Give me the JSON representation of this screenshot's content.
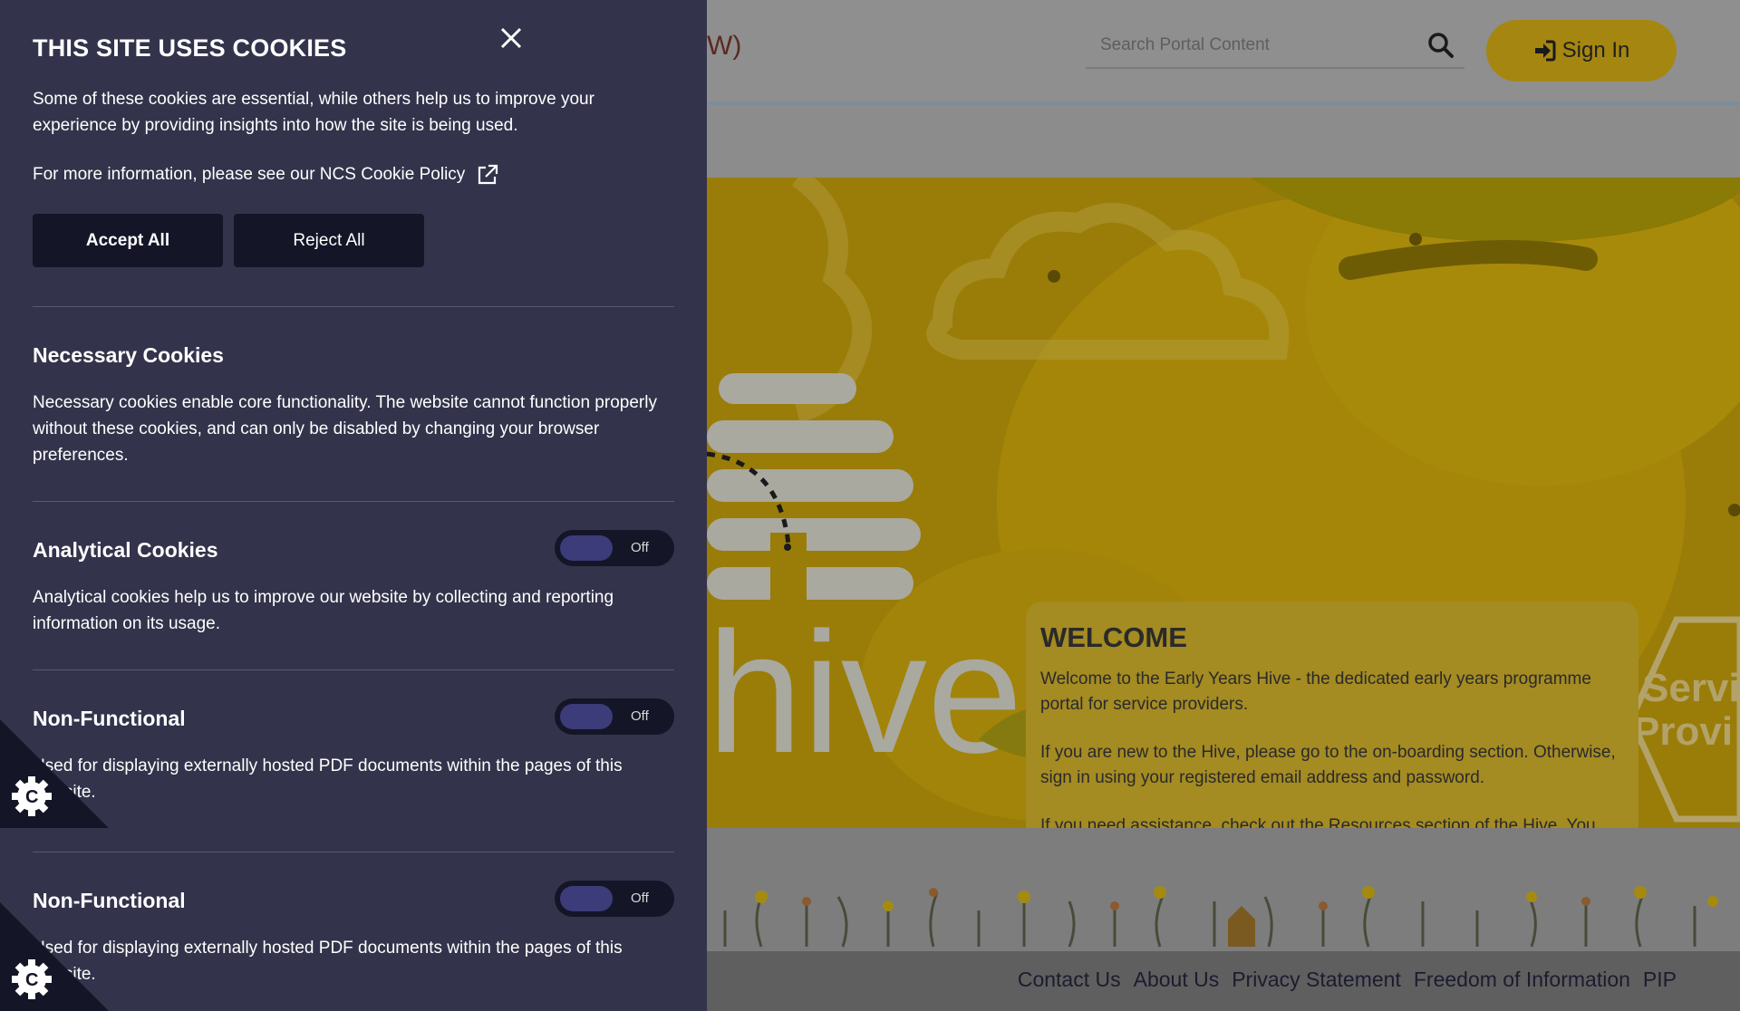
{
  "header": {
    "title_fragment": "W)",
    "search_placeholder": "Search Portal Content",
    "search_icon": "search-icon",
    "signin_label": "Sign In",
    "signin_icon": "sign-in-icon"
  },
  "hero": {
    "logo_word": "hive",
    "service_badge_line1": "Servi",
    "service_badge_line2": "Provi"
  },
  "welcome": {
    "title": "WELCOME",
    "p1": "Welcome to the Early Years Hive - the dedicated early years programme portal for service providers.",
    "p2": "If you are new to the Hive, please go to the on-boarding section. Otherwise, sign in using your registered email address and password.",
    "p3": "If you need assistance, check out the Resources section of the Hive. You can also call the Early Years Provider Centre (EYPC) Monday to Friday 9am to 5pm at 01 511 7222."
  },
  "footer": {
    "links": [
      "Contact Us",
      "About Us",
      "Privacy Statement",
      "Freedom of Information",
      "PIP"
    ]
  },
  "cookies": {
    "title": "THIS SITE USES COOKIES",
    "intro": "Some of these cookies are essential, while others help us to improve your experience by providing insights into how the site is being used.",
    "policy_text": "For more information, please see our NCS Cookie Policy",
    "accept_label": "Accept All",
    "reject_label": "Reject All",
    "sections": [
      {
        "title": "Necessary Cookies",
        "text": "Necessary cookies enable core functionality. The website cannot function properly without these cookies, and can only be disabled by changing your browser preferences."
      },
      {
        "title": "Analytical Cookies",
        "text": "Analytical cookies help us to improve our website by collecting and reporting information on its usage.",
        "toggle": "Off"
      },
      {
        "title": "Non-Functional",
        "text": "Used for displaying externally hosted PDF documents within the pages of this website.",
        "toggle": "Off"
      },
      {
        "title": "Non-Functional",
        "text": "Used for displaying externally hosted PDF documents within the pages of this website.",
        "toggle": "Off"
      }
    ]
  },
  "colors": {
    "panel": "#33334b",
    "panel_button": "#151528",
    "toggle_knob": "#3c3c7a",
    "hero_yellow": "#9a7d08",
    "signin": "#a58610"
  }
}
